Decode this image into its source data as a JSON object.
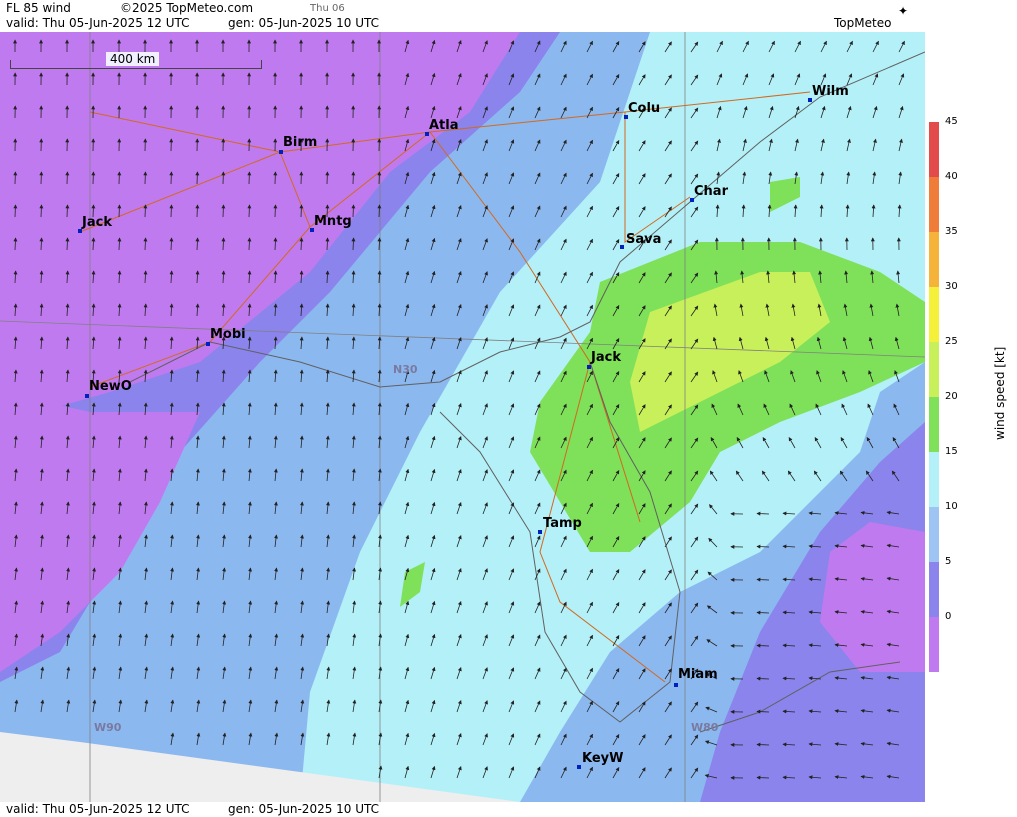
{
  "header": {
    "product": "FL 85 wind",
    "copyright": "©2025 TopMeteo.com",
    "day": "Thu 06",
    "valid": "valid:  Thu  05-Jun-2025  12 UTC",
    "gen": "gen: 05-Jun-2025 10 UTC",
    "logo": "TopMeteo"
  },
  "footer": {
    "valid": "valid:  Thu  05-Jun-2025  12 UTC",
    "gen": "gen: 05-Jun-2025 10 UTC"
  },
  "scale": {
    "label": "400 km"
  },
  "cities": [
    {
      "name": "Birm"
    },
    {
      "name": "Atla"
    },
    {
      "name": "Colu"
    },
    {
      "name": "Wilm"
    },
    {
      "name": "Char"
    },
    {
      "name": "Jack"
    },
    {
      "name": "Mntg"
    },
    {
      "name": "Sava"
    },
    {
      "name": "Mobi"
    },
    {
      "name": "Jack"
    },
    {
      "name": "NewO"
    },
    {
      "name": "Tamp"
    },
    {
      "name": "Miam"
    },
    {
      "name": "KeyW"
    }
  ],
  "grid_labels": {
    "lat": "N30",
    "lon_w": "W90",
    "lon_e": "W80"
  },
  "legend": {
    "title": "wind speed [kt]",
    "ticks": [
      "45",
      "40",
      "35",
      "30",
      "25",
      "20",
      "15",
      "10",
      "5",
      "0"
    ],
    "colors": [
      "#e34a4a",
      "#f07c3a",
      "#f5b33a",
      "#f5f03a",
      "#c8f05a",
      "#7fe05a",
      "#b4f0f8",
      "#9ec4f4",
      "#8a84ec",
      "#c07af0"
    ]
  }
}
